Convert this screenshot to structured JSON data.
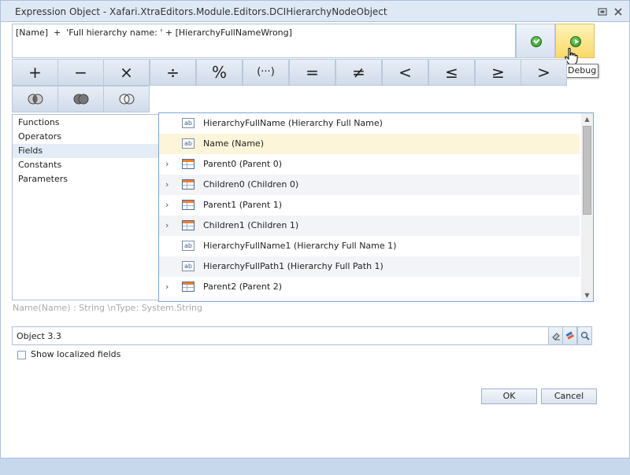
{
  "window": {
    "title": "Expression Object - Xafari.XtraEditors.Module.Editors.DCIHierarchyNodeObject",
    "controls": [
      "restore-icon",
      "close-icon"
    ]
  },
  "expression": {
    "text": "[Name]  +  'Full hierarchy name: ' + [HierarchyFullNameWrong]"
  },
  "side_buttons": {
    "validate_icon": "check-circle-icon",
    "debug_icon": "play-circle-icon",
    "tooltip": "Debug"
  },
  "operators": {
    "row1": [
      "+",
      "−",
      "×",
      "÷",
      "%",
      "(···)",
      "=",
      "≠",
      "<",
      "≤",
      "≥",
      ">"
    ],
    "row2_icons": [
      "venn-intersect-icon",
      "venn-union-icon",
      "venn-except-icon"
    ]
  },
  "categories": [
    {
      "label": "Functions",
      "selected": false
    },
    {
      "label": "Operators",
      "selected": false
    },
    {
      "label": "Fields",
      "selected": true
    },
    {
      "label": "Constants",
      "selected": false
    },
    {
      "label": "Parameters",
      "selected": false
    }
  ],
  "fields": [
    {
      "label": "HierarchyFullName (Hierarchy Full Name)",
      "icon": "ab",
      "expandable": false,
      "highlighted": false
    },
    {
      "label": "Name (Name)",
      "icon": "ab",
      "expandable": false,
      "highlighted": true
    },
    {
      "label": "Parent0 (Parent 0)",
      "icon": "table",
      "expandable": true,
      "highlighted": false
    },
    {
      "label": "Children0 (Children 0)",
      "icon": "table",
      "expandable": true,
      "highlighted": false
    },
    {
      "label": "Parent1 (Parent 1)",
      "icon": "table",
      "expandable": true,
      "highlighted": false
    },
    {
      "label": "Children1 (Children 1)",
      "icon": "table",
      "expandable": true,
      "highlighted": false
    },
    {
      "label": "HierarchyFullName1 (Hierarchy Full Name 1)",
      "icon": "ab",
      "expandable": false,
      "highlighted": false
    },
    {
      "label": "HierarchyFullPath1 (Hierarchy Full Path 1)",
      "icon": "ab",
      "expandable": false,
      "highlighted": false
    },
    {
      "label": "Parent2 (Parent 2)",
      "icon": "table",
      "expandable": true,
      "highlighted": false
    }
  ],
  "description": "Name(Name) : String \\nType: System.String",
  "object_field": {
    "value": "Object 3.3",
    "buttons": [
      "eraser-icon",
      "clear-icon",
      "search-icon"
    ]
  },
  "show_localized": {
    "label": "Show localized fields",
    "checked": false
  },
  "buttons": {
    "ok": "OK",
    "cancel": "Cancel"
  },
  "colors": {
    "title_bg": "#dfe9f5",
    "highlight_row": "#fdf5d9",
    "selected_category": "#e3ecf7",
    "list_border": "#7ba7d8"
  }
}
